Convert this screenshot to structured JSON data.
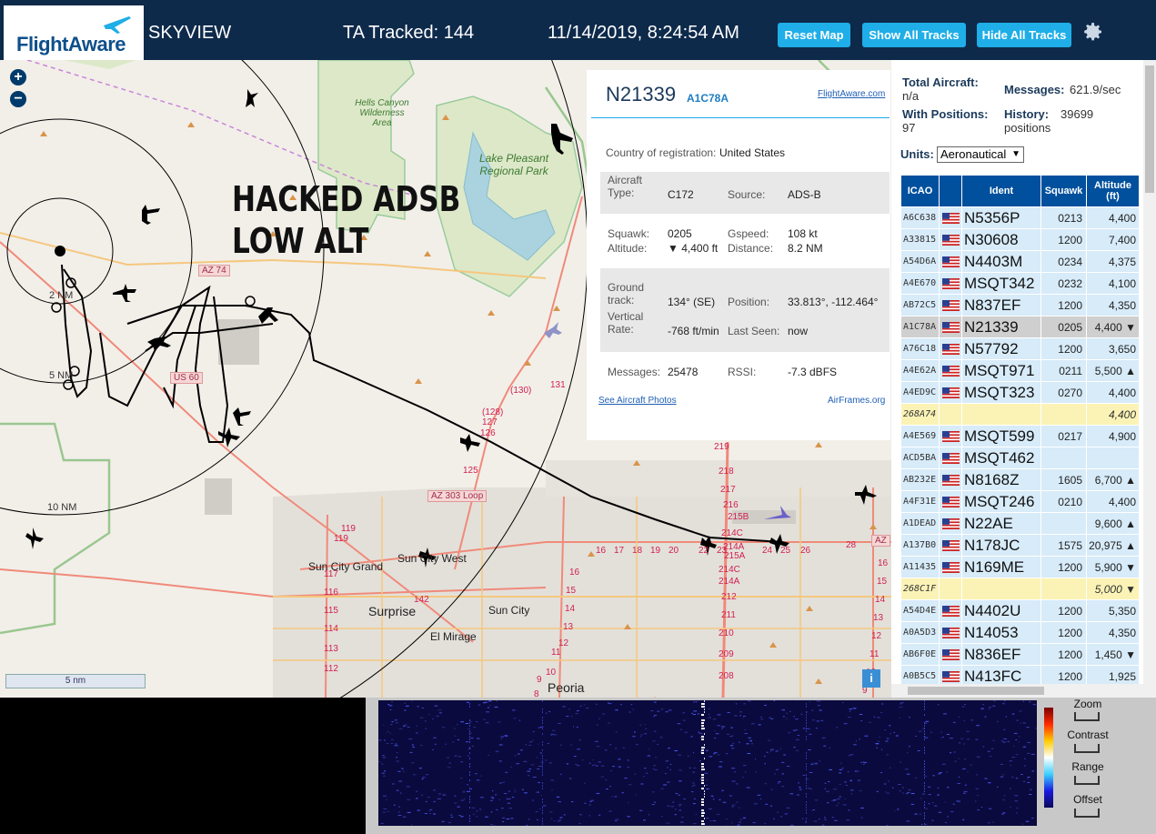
{
  "header": {
    "logo_text": "FlightAware",
    "app_name": "SKYVIEW",
    "tracked_text": "TA Tracked: 144",
    "datetime": "11/14/2019, 8:24:54 AM",
    "buttons": {
      "reset": "Reset Map",
      "show_all": "Show All Tracks",
      "hide_all": "Hide All Tracks"
    },
    "accent_color": "#1faee8",
    "bg_color": "#0e2a4b"
  },
  "map": {
    "zoom_in": "+",
    "zoom_out": "−",
    "overlay_text_line1": "HACKED ADSB",
    "overlay_text_line2": "LOW ALT",
    "range_labels": [
      "2 NM",
      "5 NM",
      "10 NM"
    ],
    "places": {
      "hells_canyon": "Hells Canyon Wilderness Area",
      "lake_pleasant": "Lake Pleasant Regional Park",
      "sun_city_grand": "Sun City Grand",
      "sun_city_west": "Sun City West",
      "sun_city": "Sun City",
      "surprise": "Surprise",
      "el_mirage": "El Mirage",
      "peoria": "Peoria"
    },
    "road_labels": {
      "az74": "AZ 74",
      "us60": "US 60",
      "az303": "AZ 303 Loop",
      "az_edge": "AZ"
    },
    "road_numbers": [
      "(130)",
      "131",
      "(128)",
      "127",
      "126",
      "125",
      "219",
      "218",
      "217",
      "216",
      "215B",
      "214C",
      "214A",
      "215A",
      "214C",
      "214A",
      "212",
      "211",
      "210",
      "209",
      "208",
      "16",
      "17",
      "18",
      "19",
      "20",
      "22",
      "23",
      "24",
      "25",
      "26",
      "28",
      "119",
      "119",
      "117",
      "116",
      "115",
      "114",
      "113",
      "112",
      "142",
      "16",
      "15",
      "14",
      "13",
      "12",
      "11",
      "10",
      "9",
      "8",
      "16",
      "15",
      "14",
      "13",
      "12",
      "11",
      "10",
      "9"
    ],
    "scale_label": "5 nm",
    "info_icon": "i"
  },
  "selected": {
    "registration": "N21339",
    "icao": "A1C78A",
    "fa_link": "FlightAware.com",
    "country_label": "Country of registration:",
    "country": "United States",
    "aircraft_type_label": "Aircraft Type:",
    "aircraft_type": "C172",
    "source_label": "Source:",
    "source": "ADS-B",
    "squawk_label": "Squawk:",
    "squawk": "0205",
    "gspeed_label": "Gspeed:",
    "gspeed": "108 kt",
    "altitude_label": "Altitude:",
    "altitude": "▼ 4,400 ft",
    "distance_label": "Distance:",
    "distance": "8.2 NM",
    "ground_track_label": "Ground track:",
    "ground_track": "134° (SE)",
    "position_label": "Position:",
    "position": "33.813°, -112.464°",
    "vrate_label": "Vertical Rate:",
    "vrate": "-768 ft/min",
    "last_seen_label": "Last Seen:",
    "last_seen": "now",
    "messages_label": "Messages:",
    "messages": "25478",
    "rssi_label": "RSSI:",
    "rssi": "-7.3 dBFS",
    "photos_link": "See Aircraft Photos",
    "airframes_link": "AirFrames.org"
  },
  "sidebar": {
    "total_label": "Total Aircraft:",
    "total_value": "n/a",
    "messages_label": "Messages:",
    "messages_value": "621.9/sec",
    "positions_label": "With Positions:",
    "positions_value": "97",
    "history_label": "History:",
    "history_value": "39699 positions",
    "units_label": "Units:",
    "units_value": "Aeronautical",
    "columns": [
      "ICAO",
      "",
      "Ident",
      "Squawk",
      "Altitude (ft)"
    ],
    "rows": [
      {
        "icao": "A6C638",
        "flag": true,
        "ident": "N5356P",
        "squawk": "0213",
        "alt": "4,400",
        "style": "norm"
      },
      {
        "icao": "A33815",
        "flag": true,
        "ident": "N30608",
        "squawk": "1200",
        "alt": "7,400",
        "style": "norm"
      },
      {
        "icao": "A54D6A",
        "flag": true,
        "ident": "N4403M",
        "squawk": "0234",
        "alt": "4,375",
        "style": "norm"
      },
      {
        "icao": "A4E670",
        "flag": true,
        "ident": "MSQT342",
        "squawk": "0232",
        "alt": "4,100",
        "style": "norm"
      },
      {
        "icao": "AB72C5",
        "flag": true,
        "ident": "N837EF",
        "squawk": "1200",
        "alt": "4,350",
        "style": "norm"
      },
      {
        "icao": "A1C78A",
        "flag": true,
        "ident": "N21339",
        "squawk": "0205",
        "alt": "4,400 ▼",
        "style": "sel"
      },
      {
        "icao": "A76C18",
        "flag": true,
        "ident": "N57792",
        "squawk": "1200",
        "alt": "3,650",
        "style": "norm"
      },
      {
        "icao": "A4E62A",
        "flag": true,
        "ident": "MSQT971",
        "squawk": "0211",
        "alt": "5,500 ▲",
        "style": "norm"
      },
      {
        "icao": "A4ED9C",
        "flag": true,
        "ident": "MSQT323",
        "squawk": "0270",
        "alt": "4,400",
        "style": "norm"
      },
      {
        "icao": "268A74",
        "flag": false,
        "ident": "",
        "squawk": "",
        "alt": "4,400",
        "style": "yel"
      },
      {
        "icao": "A4E569",
        "flag": true,
        "ident": "MSQT599",
        "squawk": "0217",
        "alt": "4,900",
        "style": "norm"
      },
      {
        "icao": "ACD5BA",
        "flag": true,
        "ident": "MSQT462",
        "squawk": "",
        "alt": "",
        "style": "norm"
      },
      {
        "icao": "AB232E",
        "flag": true,
        "ident": "N8168Z",
        "squawk": "1605",
        "alt": "6,700 ▲",
        "style": "norm"
      },
      {
        "icao": "A4F31E",
        "flag": true,
        "ident": "MSQT246",
        "squawk": "0210",
        "alt": "4,400",
        "style": "norm"
      },
      {
        "icao": "A1DEAD",
        "flag": true,
        "ident": "N22AE",
        "squawk": "",
        "alt": "9,600 ▲",
        "style": "norm"
      },
      {
        "icao": "A137B0",
        "flag": true,
        "ident": "N178JC",
        "squawk": "1575",
        "alt": "20,975 ▲",
        "style": "norm"
      },
      {
        "icao": "A11435",
        "flag": true,
        "ident": "N169ME",
        "squawk": "1200",
        "alt": "5,900 ▼",
        "style": "norm"
      },
      {
        "icao": "268C1F",
        "flag": false,
        "ident": "",
        "squawk": "",
        "alt": "5,000 ▼",
        "style": "yel"
      },
      {
        "icao": "A54D4E",
        "flag": true,
        "ident": "N4402U",
        "squawk": "1200",
        "alt": "5,350",
        "style": "norm"
      },
      {
        "icao": "A0A5D3",
        "flag": true,
        "ident": "N14053",
        "squawk": "1200",
        "alt": "4,350",
        "style": "norm"
      },
      {
        "icao": "AB6F0E",
        "flag": true,
        "ident": "N836EF",
        "squawk": "1200",
        "alt": "1,450 ▼",
        "style": "norm"
      },
      {
        "icao": "A0B5C5",
        "flag": true,
        "ident": "N413FC",
        "squawk": "1200",
        "alt": "1,925",
        "style": "norm"
      }
    ]
  },
  "waterfall": {
    "controls": [
      "Zoom",
      "Contrast",
      "Range",
      "Offset"
    ]
  }
}
